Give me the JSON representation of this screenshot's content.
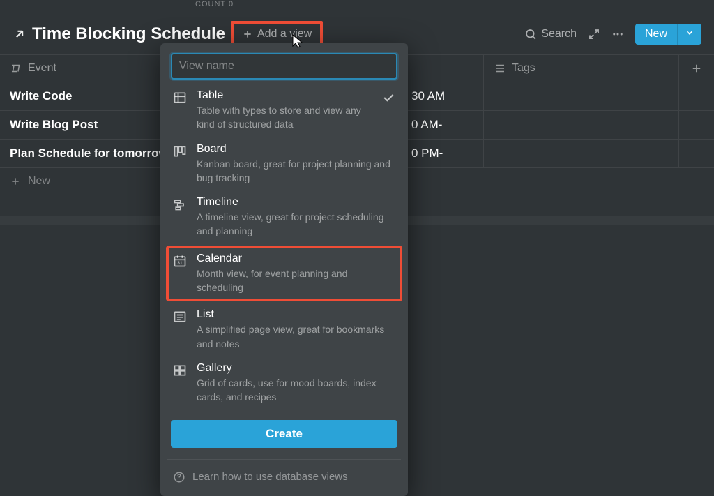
{
  "top_fragment": "COUNT 0",
  "header": {
    "title": "Time Blocking Schedule",
    "add_view_label": "Add a view",
    "search_label": "Search",
    "new_label": "New"
  },
  "columns": {
    "event": "Event",
    "time": "",
    "tags": "Tags"
  },
  "rows": [
    {
      "event": "Write Code",
      "time": "30 AM"
    },
    {
      "event": "Write Blog Post",
      "time": "0 AM-"
    },
    {
      "event": "Plan Schedule for tomorrow",
      "time": "0 PM-"
    }
  ],
  "new_row_label": "New",
  "popover": {
    "placeholder": "View name",
    "options": [
      {
        "title": "Table",
        "desc": "Table with types to store and view any kind of structured data",
        "selected": true,
        "icon": "table"
      },
      {
        "title": "Board",
        "desc": "Kanban board, great for project planning and bug tracking",
        "selected": false,
        "icon": "board"
      },
      {
        "title": "Timeline",
        "desc": "A timeline view, great for project scheduling and planning",
        "selected": false,
        "icon": "timeline"
      },
      {
        "title": "Calendar",
        "desc": "Month view, for event planning and scheduling",
        "selected": false,
        "icon": "calendar",
        "highlighted": true
      },
      {
        "title": "List",
        "desc": "A simplified page view, great for bookmarks and notes",
        "selected": false,
        "icon": "list"
      },
      {
        "title": "Gallery",
        "desc": "Grid of cards, use for mood boards, index cards, and recipes",
        "selected": false,
        "icon": "gallery"
      }
    ],
    "create_label": "Create",
    "learn_label": "Learn how to use database views"
  }
}
